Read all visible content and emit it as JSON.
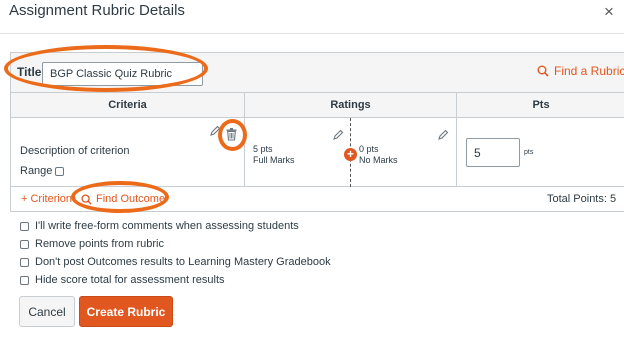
{
  "dialog": {
    "title": "Assignment Rubric Details",
    "close_icon": "×"
  },
  "rubric": {
    "title_label": "Title:",
    "title_value": "BGP Classic Quiz Rubric",
    "find_rubric_label": "Find a Rubric",
    "columns": {
      "criteria": "Criteria",
      "ratings": "Ratings",
      "pts": "Pts"
    },
    "criterion": {
      "description": "Description of criterion",
      "range_label": "Range",
      "range_checked": false
    },
    "ratings": [
      {
        "points": "5 pts",
        "description": "Full Marks"
      },
      {
        "points": "0 pts",
        "description": "No Marks"
      }
    ],
    "add_rating_icon": "+",
    "points_value": "5",
    "points_unit": "pts",
    "add_criterion_label": "+ Criterion",
    "find_outcome_label": "Find Outcome",
    "total_points": "Total Points: 5"
  },
  "options": [
    {
      "label": "I'll write free-form comments when assessing students",
      "checked": false
    },
    {
      "label": "Remove points from rubric",
      "checked": false
    },
    {
      "label": "Don't post Outcomes results to Learning Mastery Gradebook",
      "checked": false
    },
    {
      "label": "Hide score total for assessment results",
      "checked": false
    }
  ],
  "buttons": {
    "cancel": "Cancel",
    "create": "Create Rubric"
  },
  "colors": {
    "accent": "#e0571f",
    "highlight": "#ec6b1b",
    "border": "#c7cdd1",
    "header_bg": "#f5f5f5"
  },
  "icons": [
    "close-icon",
    "search-icon",
    "pencil-icon",
    "trash-icon",
    "plus-circle-icon"
  ]
}
